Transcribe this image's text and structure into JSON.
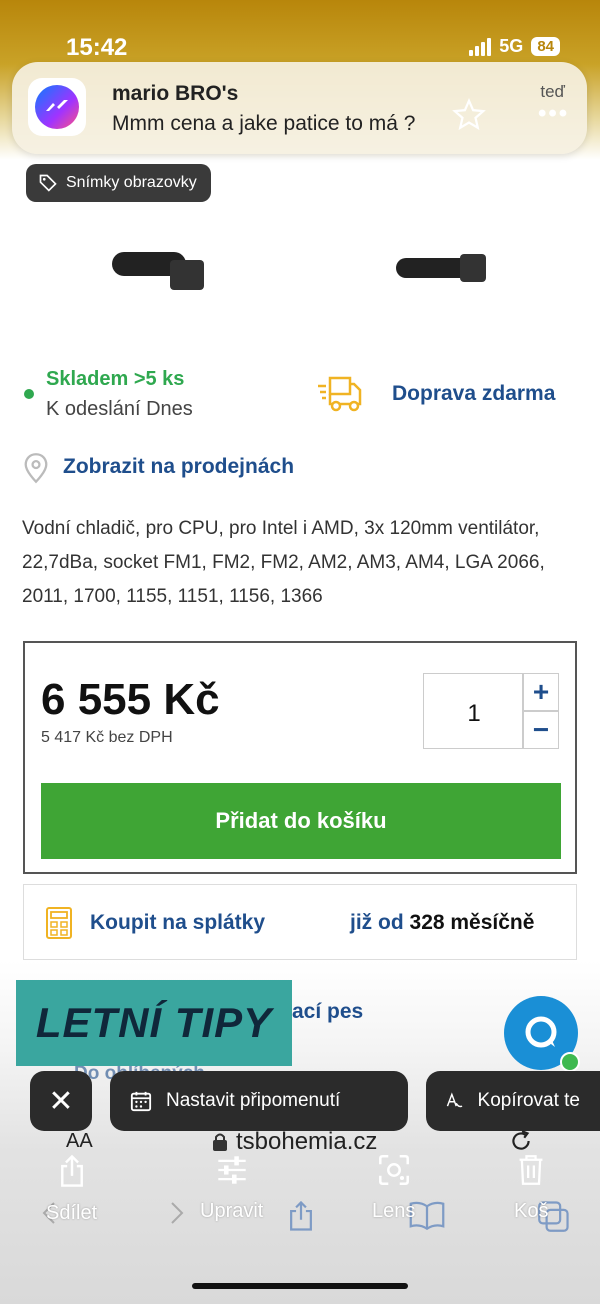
{
  "status_bar": {
    "time": "15:42",
    "network": "5G",
    "battery": "84"
  },
  "notification": {
    "app": "Messenger",
    "sender": "mario BRO's",
    "message": "Mmm cena a jake patice to má ?",
    "time": "teď"
  },
  "screenshot_tag": "Snímky obrazovky",
  "availability": {
    "stock_status": "Skladem >5 ks",
    "dispatch": "K odeslání Dnes",
    "shipping": "Doprava zdarma",
    "stores_link": "Zobrazit na prodejnách"
  },
  "description": "Vodní chladič, pro CPU, pro Intel i AMD, 3x 120mm ventilátor, 22,7dBa, socket FM1, FM2, FM2, AM2, AM3, AM4, LGA 2066, 2011, 1700, 1155, 1151, 1156, 1366",
  "purchase": {
    "price": "6 555 Kč",
    "price_without_vat": "5 417 Kč bez DPH",
    "quantity": "1",
    "plus": "+",
    "minus": "−",
    "add_to_cart": "Přidat do košíku"
  },
  "installment": {
    "label": "Koupit na splátky",
    "from_prefix": "již od",
    "amount": "328 měsíčně"
  },
  "overlay": {
    "banner": "LETNÍ TIPY",
    "partial_link": "ací pes",
    "partial_favorites": "Do oblíbených"
  },
  "actions": {
    "close": "✕",
    "reminder": "Nastavit připomenutí",
    "copy": "Kopírovat te"
  },
  "safari": {
    "text_size": "AA",
    "url": "tsbohemia.cz"
  },
  "toolbar": {
    "share": "Sdílet",
    "edit": "Upravit",
    "lens": "Lens",
    "delete": "Koš"
  },
  "colors": {
    "accent_blue": "#1f4e8c",
    "in_stock_green": "#2fa84f",
    "cart_button": "#3fa535",
    "banner": "#3aa69f"
  }
}
